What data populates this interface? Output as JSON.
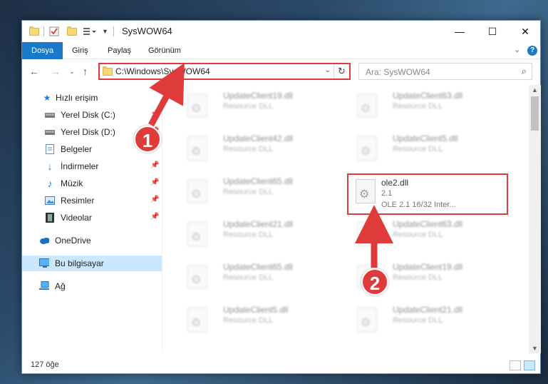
{
  "window": {
    "title": "SysWOW64",
    "minimize": "—",
    "maximize": "☐",
    "close": "✕"
  },
  "ribbon": {
    "tabs": [
      "Dosya",
      "Giriş",
      "Paylaş",
      "Görünüm"
    ],
    "help": "?"
  },
  "nav": {
    "address": "C:\\Windows\\SysWOW64",
    "search_placeholder": "Ara: SysWOW64"
  },
  "sidebar": {
    "items": [
      {
        "label": "Hızlı erişim",
        "icon": "star-icon",
        "pinned": false
      },
      {
        "label": "Yerel Disk (C:)",
        "icon": "drive-icon",
        "pinned": true
      },
      {
        "label": "Yerel Disk (D:)",
        "icon": "drive-icon",
        "pinned": true
      },
      {
        "label": "Belgeler",
        "icon": "documents-icon",
        "pinned": true
      },
      {
        "label": "İndirmeler",
        "icon": "download-icon",
        "pinned": true
      },
      {
        "label": "Müzik",
        "icon": "music-icon",
        "pinned": true
      },
      {
        "label": "Resimler",
        "icon": "pictures-icon",
        "pinned": true
      },
      {
        "label": "Videolar",
        "icon": "videos-icon",
        "pinned": true
      },
      {
        "label": "OneDrive",
        "icon": "cloud-icon",
        "pinned": false
      },
      {
        "label": "Bu bilgisayar",
        "icon": "computer-icon",
        "pinned": false,
        "selected": true
      },
      {
        "label": "Ağ",
        "icon": "network-icon",
        "pinned": false
      }
    ]
  },
  "files": [
    {
      "name": "UpdateClient19.dll",
      "sub": "Resource DLL"
    },
    {
      "name": "UpdateClient63.dll",
      "sub": "Resource DLL"
    },
    {
      "name": "UpdateClient42.dll",
      "sub": "Resource DLL"
    },
    {
      "name": "UpdateClient5.dll",
      "sub": "Resource DLL"
    },
    {
      "name": "UpdateClient65.dll",
      "sub": "Resource DLL"
    },
    {
      "name": "ole2.dll",
      "sub": "2.1",
      "sub2": "OLE 2.1 16/32 Inter..."
    },
    {
      "name": "UpdateClient21.dll",
      "sub": "Resource DLL"
    },
    {
      "name": "UpdateClient63.dll",
      "sub": "Resource DLL"
    },
    {
      "name": "UpdateClient65.dll",
      "sub": "Resource DLL"
    },
    {
      "name": "UpdateClient19.dll",
      "sub": "Resource DLL"
    },
    {
      "name": "UpdateClient5.dll",
      "sub": "Resource DLL"
    },
    {
      "name": "UpdateClient21.dll",
      "sub": "Resource DLL"
    }
  ],
  "status": {
    "count": "127 öğe"
  },
  "annotations": {
    "marker1": "1",
    "marker2": "2",
    "color": "#e03b3b"
  }
}
